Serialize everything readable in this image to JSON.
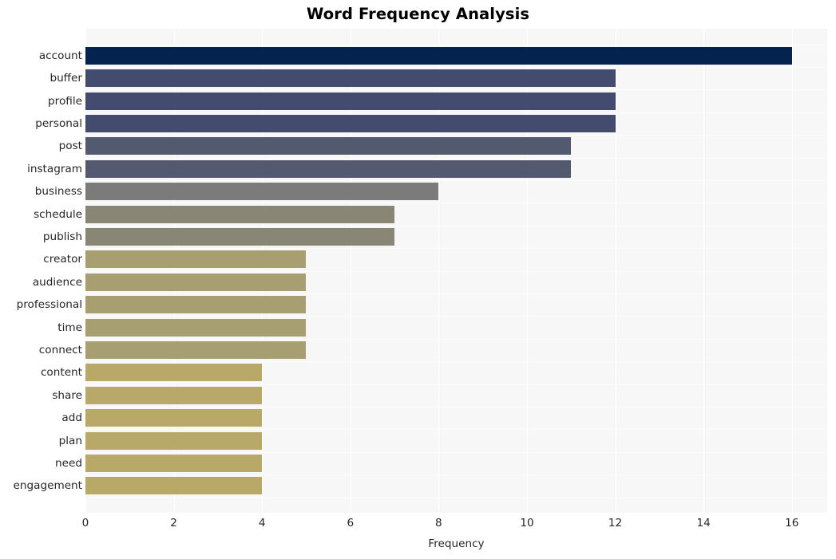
{
  "chart_data": {
    "type": "bar",
    "orientation": "horizontal",
    "title": "Word Frequency Analysis",
    "xlabel": "Frequency",
    "ylabel": "",
    "xlim": [
      0,
      16.8
    ],
    "ylim_categories": 20,
    "grid": true,
    "legend": null,
    "xticks": [
      "0",
      "2",
      "4",
      "6",
      "8",
      "10",
      "12",
      "14",
      "16"
    ],
    "xtick_values": [
      0,
      2,
      4,
      6,
      8,
      10,
      12,
      14,
      16
    ],
    "categories": [
      "account",
      "buffer",
      "profile",
      "personal",
      "post",
      "instagram",
      "business",
      "schedule",
      "publish",
      "creator",
      "audience",
      "professional",
      "time",
      "connect",
      "content",
      "share",
      "add",
      "plan",
      "need",
      "engagement"
    ],
    "values": [
      16,
      12,
      12,
      12,
      11,
      11,
      8,
      7,
      7,
      5,
      5,
      5,
      5,
      5,
      4,
      4,
      4,
      4,
      4,
      4
    ],
    "bar_colors": [
      "#04244f",
      "#434c6e",
      "#434c6e",
      "#434c6e",
      "#535a70",
      "#535a70",
      "#7b7b79",
      "#8a8676",
      "#8a8676",
      "#a79f72",
      "#a79f72",
      "#a79f72",
      "#a79f72",
      "#a79f72",
      "#b8a968",
      "#b8a968",
      "#b8a968",
      "#b8a968",
      "#b8a968",
      "#b8a968"
    ],
    "plot_background": "#f7f7f7",
    "figure_background": "#ffffff",
    "gridline_color": "#ffffff"
  }
}
